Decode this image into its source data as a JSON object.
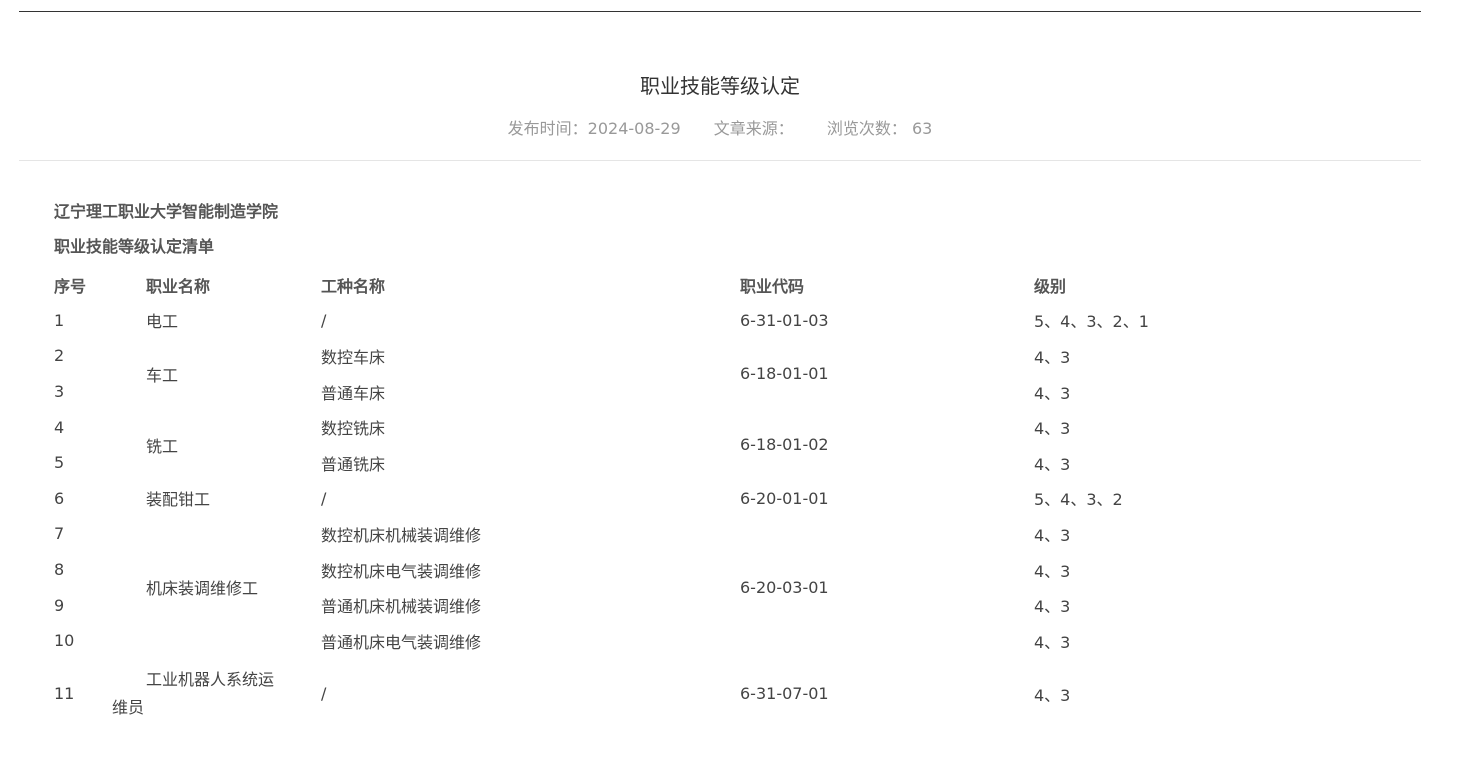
{
  "article": {
    "title": "职业技能等级认定",
    "meta": {
      "publish_time": "发布时间：2024-08-29",
      "source": "文章来源：",
      "views": "浏览次数：  63"
    }
  },
  "content": {
    "org": "辽宁理工职业大学智能制造学院",
    "list_title": "职业技能等级认定清单",
    "table": {
      "headers": [
        "序号",
        "职业名称",
        "工种名称",
        "职业代码",
        "级别"
      ],
      "rows": [
        {
          "no": "1",
          "occupation": "电工",
          "trade": "/",
          "code": "6-31-01-03",
          "level": "5、4、3、2、1"
        },
        {
          "no": "2",
          "occupation": "车工",
          "trade": "数控车床",
          "code": "6-18-01-01",
          "level": "4、3"
        },
        {
          "no": "3",
          "trade": "普通车床",
          "level": "4、3"
        },
        {
          "no": "4",
          "occupation": "铣工",
          "trade": "数控铣床",
          "code": "6-18-01-02",
          "level": "4、3"
        },
        {
          "no": "5",
          "trade": "普通铣床",
          "level": "4、3"
        },
        {
          "no": "6",
          "occupation": "装配钳工",
          "trade": "/",
          "code": "6-20-01-01",
          "level": "5、4、3、2"
        },
        {
          "no": "7",
          "occupation": "机床装调维修工",
          "trade": "数控机床机械装调维修",
          "code": "6-20-03-01",
          "level": "4、3"
        },
        {
          "no": "8",
          "trade": "数控机床电气装调维修",
          "level": "4、3"
        },
        {
          "no": "9",
          "trade": "普通机床机械装调维修",
          "level": "4、3"
        },
        {
          "no": "10",
          "trade": "普通机床电气装调维修",
          "level": "4、3"
        },
        {
          "no": "11",
          "occupation_line1": "工业机器人系统运",
          "occupation_line2": "维员",
          "trade": "/",
          "code": "6-31-07-01",
          "level": "4、3"
        }
      ]
    }
  }
}
